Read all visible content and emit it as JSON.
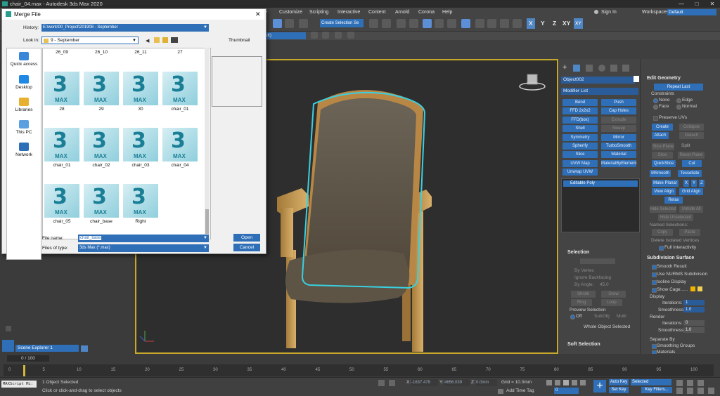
{
  "window": {
    "title": "chair_04.max - Autodesk 3ds Max 2020",
    "minimize": "—",
    "maximize": "□",
    "close": "✕"
  },
  "menu": {
    "items": [
      "Customize",
      "Scripting",
      "Interactive",
      "Content",
      "Arnold",
      "Corona",
      "Help"
    ],
    "sign_in": "Sign In",
    "workspaces_label": "Workspaces:",
    "workspaces_value": "Default"
  },
  "toolbar": {
    "selection_set": "Create Selection Se",
    "axis_x": "X",
    "axis_y": "Y",
    "axis_z": "Z",
    "axis_xy": "XY",
    "ribbon_value": "ult)"
  },
  "dialog": {
    "title": "Merge File",
    "history_label": "History:",
    "history_value": "E:\\work\\00_Project\\201908 - September",
    "lookin_label": "Look in:",
    "lookin_value": "9 - September",
    "thumbnail_label": "Thumbnail",
    "places": [
      "Quick access",
      "Desktop",
      "Libraries",
      "This PC",
      "Network"
    ],
    "top_row": [
      "26_09",
      "26_10",
      "26_11",
      "27"
    ],
    "files": [
      "28",
      "29",
      "30",
      "chair_01",
      "chair_01",
      "chair_02",
      "chair_03",
      "chair_04",
      "chair_05",
      "chair_base",
      "Right"
    ],
    "file_name_label": "File name:",
    "file_name_value": "chair_base",
    "files_of_type_label": "Files of type:",
    "files_of_type_value": "3ds Max (*.max)",
    "open_button": "Open",
    "cancel_button": "Cancel",
    "thumb_digit": "3",
    "thumb_text": "MAX"
  },
  "command_panel": {
    "object_name": "Object002",
    "modifier_list": "Modifier List",
    "modifiers": [
      "Bend",
      "Push",
      "FFD 2x2x2",
      "Cap Holes",
      "FFD(box)",
      "Extrude",
      "Shell",
      "Sweep",
      "Symmetry",
      "Mirror",
      "Spherify",
      "TurboSmooth",
      "Slice",
      "Material",
      "UVW Map",
      "MaterialByElement",
      "Unwrap UVW"
    ],
    "modifiers_enabled": [
      true,
      true,
      true,
      true,
      true,
      false,
      true,
      false,
      true,
      true,
      true,
      true,
      true,
      true,
      true,
      true,
      true
    ],
    "stack_item": "Editable Poly",
    "selection_title": "Selection",
    "by_vertex": "By Vertex",
    "ignore_backfacing": "Ignore Backfacing",
    "by_angle": "By Angle:",
    "by_angle_value": "45.0",
    "shrink": "Shrink",
    "grow": "Grow",
    "ring": "Ring",
    "loop": "Loop",
    "preview_selection": "Preview Selection",
    "preview_off": "Off",
    "preview_subobj": "SubObj",
    "preview_multi": "Multi",
    "whole_object_selected": "Whole Object Selected",
    "soft_selection_title": "Soft Selection"
  },
  "edit_geometry": {
    "title": "Edit Geometry",
    "repeat_last": "Repeat Last",
    "constraints": "Constraints",
    "none": "None",
    "edge": "Edge",
    "face": "Face",
    "normal": "Normal",
    "preserve_uvs": "Preserve UVs",
    "create": "Create",
    "collapse": "Collapse",
    "attach": "Attach",
    "detach": "Detach",
    "slice_plane": "Slice Plane",
    "split": "Split",
    "slice": "Slice",
    "reset_plane": "Reset Plane",
    "quickslice": "QuickSlice",
    "cut": "Cut",
    "msmooth": "MSmooth",
    "tessellate": "Tessellate",
    "make_planar": "Make Planar",
    "x": "X",
    "y": "Y",
    "z": "Z",
    "view_align": "View Align",
    "grid_align": "Grid Align",
    "relax": "Relax",
    "hide_selected": "Hide Selected",
    "unhide_all": "Unhide All",
    "hide_unselected": "Hide Unselected",
    "named_selections": "Named Selections:",
    "copy": "Copy",
    "paste": "Paste",
    "delete_isolated": "Delete Isolated Vertices",
    "full_interactivity": "Full Interactivity",
    "subdivision_title": "Subdivision Surface",
    "smooth_result": "Smooth Result",
    "use_nurms": "Use NURMS Subdivision",
    "isoline_display": "Isoline Display",
    "show_cage": "Show Cage......",
    "display": "Display",
    "iterations": "Iterations:",
    "iterations_value": "1",
    "smoothness": "Smoothness:",
    "smoothness_value": "1.0",
    "render": "Render",
    "render_iterations_value": "0",
    "render_smoothness_value": "1.0",
    "separate_by": "Separate By",
    "smoothing_groups": "Smoothing Groups",
    "materials": "Materials"
  },
  "timeline": {
    "scene_explorer": "Scene Explorer 1",
    "frame_counter": "0 / 100",
    "ticks": [
      "0",
      "5",
      "10",
      "15",
      "20",
      "25",
      "30",
      "35",
      "40",
      "45",
      "50",
      "55",
      "60",
      "65",
      "70",
      "75",
      "80",
      "85",
      "90",
      "95",
      "100"
    ]
  },
  "status": {
    "maxscript": "MAXScript Mi:",
    "objects_selected": "1 Object Selected",
    "prompt": "Click or click-and-drag to select objects",
    "x_label": "X:",
    "x_value": "-1637.479",
    "y_label": "Y:",
    "y_value": "4656.039",
    "z_label": "Z:",
    "z_value": "0.0mm",
    "grid": "Grid = 10.0mm",
    "add_time_tag": "Add Time Tag",
    "auto_key": "Auto Key",
    "set_key": "Set Key",
    "selected_value": "Selected",
    "key_filters": "Key Filters...",
    "frame_value": "0"
  }
}
